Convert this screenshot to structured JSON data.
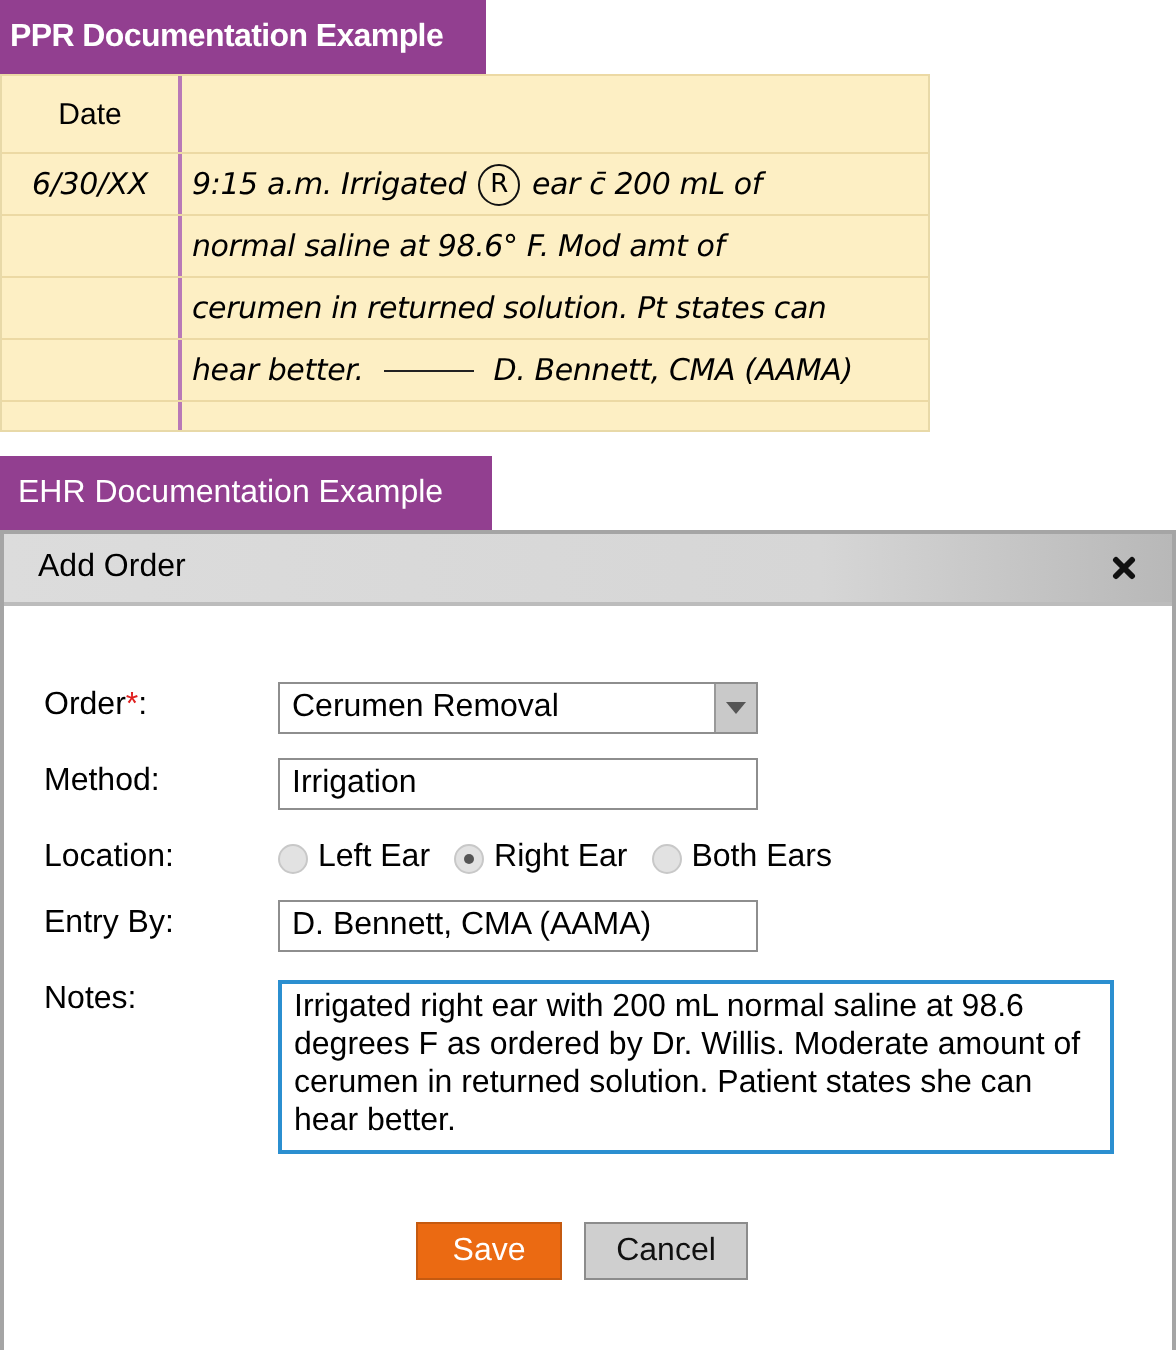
{
  "ppr": {
    "title": "PPR Documentation Example",
    "header": {
      "date": "Date"
    },
    "rows": [
      {
        "date": "6/30/XX",
        "segments": [
          {
            "kind": "text",
            "text": "9:15 a.m.  Irrigated"
          },
          {
            "kind": "circled",
            "text": "R"
          },
          {
            "kind": "text",
            "text": "ear c̄ 200 mL of"
          }
        ]
      },
      {
        "segments": [
          {
            "kind": "text",
            "text": "normal saline at 98.6° F. Mod amt of"
          }
        ]
      },
      {
        "segments": [
          {
            "kind": "text",
            "text": "cerumen in returned solution. Pt states can"
          }
        ]
      },
      {
        "segments": [
          {
            "kind": "text",
            "text": "hear better."
          },
          {
            "kind": "rule"
          },
          {
            "kind": "text",
            "text": "D. Bennett, CMA (AAMA)"
          }
        ]
      },
      {
        "segments": []
      }
    ]
  },
  "ehr": {
    "title": "EHR Documentation Example",
    "dialog": {
      "title": "Add Order",
      "fields": [
        {
          "kind": "dropdown",
          "label": "Order",
          "required_mark": "*",
          "label_end": ":",
          "value": "Cerumen Removal"
        },
        {
          "kind": "text",
          "label": "Method:",
          "value": "Irrigation"
        },
        {
          "kind": "radio",
          "label": "Location:",
          "options": [
            {
              "label": "Left Ear",
              "selected": false
            },
            {
              "label": "Right Ear",
              "selected": true
            },
            {
              "label": "Both Ears",
              "selected": false
            }
          ]
        },
        {
          "kind": "text",
          "label": "Entry By:",
          "value": "D. Bennett, CMA (AAMA)"
        },
        {
          "kind": "textarea",
          "label": "Notes:",
          "value": "Irrigated right ear with 200 mL normal saline at 98.6 degrees F as ordered by Dr. Willis. Moderate amount of cerumen in returned solution. Patient states she can hear better."
        }
      ],
      "buttons": [
        {
          "label": "Save",
          "kind": "primary"
        },
        {
          "label": "Cancel",
          "kind": "secondary"
        }
      ]
    }
  }
}
